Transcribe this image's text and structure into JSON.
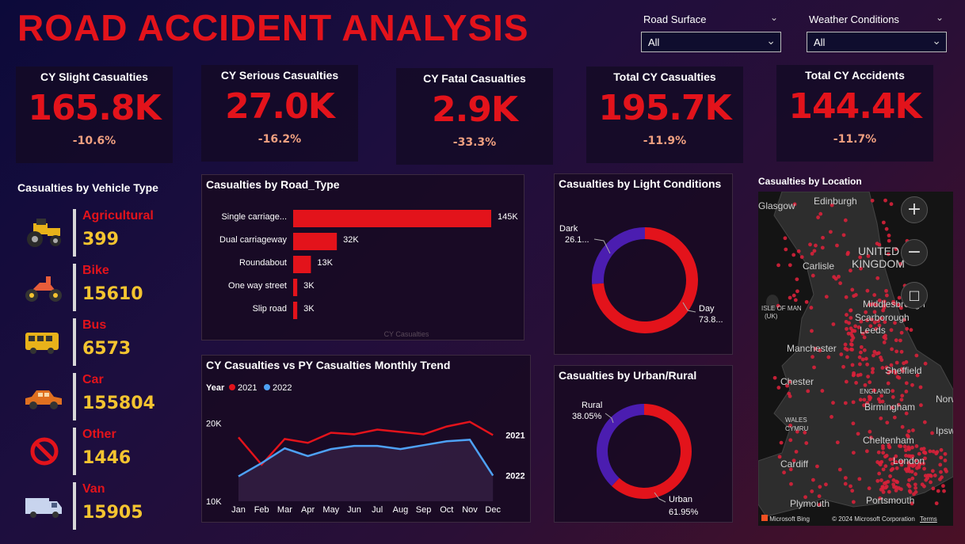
{
  "title": "ROAD ACCIDENT ANALYSIS",
  "filters": [
    {
      "label": "Road Surface",
      "value": "All"
    },
    {
      "label": "Weather Conditions",
      "value": "All"
    }
  ],
  "kpis": [
    {
      "title": "CY Slight Casualties",
      "value": "165.8K",
      "change": "-10.6%"
    },
    {
      "title": "CY Serious Casualties",
      "value": "27.0K",
      "change": "-16.2%"
    },
    {
      "title": "CY Fatal Casualties",
      "value": "2.9K",
      "change": "-33.3%"
    },
    {
      "title": "Total CY Casualties",
      "value": "195.7K",
      "change": "-11.9%"
    },
    {
      "title": "Total CY Accidents",
      "value": "144.4K",
      "change": "-11.7%"
    }
  ],
  "vehicle": {
    "title": "Casualties by Vehicle Type",
    "items": [
      {
        "name": "Agricultural",
        "value": "399",
        "icon": "tractor-icon"
      },
      {
        "name": "Bike",
        "value": "15610",
        "icon": "motorbike-icon"
      },
      {
        "name": "Bus",
        "value": "6573",
        "icon": "bus-icon"
      },
      {
        "name": "Car",
        "value": "155804",
        "icon": "car-icon"
      },
      {
        "name": "Other",
        "value": "1446",
        "icon": "prohibited-icon"
      },
      {
        "name": "Van",
        "value": "15905",
        "icon": "van-icon"
      }
    ]
  },
  "road_type": {
    "title": "Casualties by Road_Type",
    "axis_label": "CY Casualties"
  },
  "trend": {
    "title": "CY Casualties vs PY Casualties Monthly Trend",
    "legend_title": "Year"
  },
  "light": {
    "title": "Casualties by Light Conditions"
  },
  "urban": {
    "title": "Casualties by Urban/Rural"
  },
  "map": {
    "title": "Casualties by Location",
    "places": [
      "Edinburgh",
      "UNITED",
      "KINGDOM",
      "Carlisle",
      "ISLE OF MAN",
      "(UK)",
      "Middlesbrough",
      "Scarborough",
      "Leeds",
      "Manchester",
      "Sheffield",
      "Chester",
      "ENGLAND",
      "WALES",
      "CYMRU",
      "Birmingham",
      "Norwich",
      "Ipswich",
      "Cheltenham",
      "London",
      "Cardiff",
      "Plymouth",
      "Portsmouth",
      "Glasgow"
    ],
    "attribution_left": "Microsoft Bing",
    "attribution_right": "© 2024 Microsoft Corporation",
    "terms": "Terms"
  },
  "colors": {
    "red": "#e3131b",
    "blue": "#4ea1f5",
    "purple": "#4b1db0",
    "yellow": "#f4c430"
  },
  "chart_data": [
    {
      "type": "bar",
      "title": "Casualties by Road_Type",
      "orientation": "horizontal",
      "xlabel": "CY Casualties",
      "categories": [
        "Single carriage...",
        "Dual carriageway",
        "Roundabout",
        "One way street",
        "Slip road"
      ],
      "values": [
        145000,
        32000,
        13000,
        3000,
        3000
      ],
      "labels": [
        "145K",
        "32K",
        "13K",
        "3K",
        "3K"
      ]
    },
    {
      "type": "line",
      "title": "CY Casualties vs PY Casualties Monthly Trend",
      "categories": [
        "Jan",
        "Feb",
        "Mar",
        "Apr",
        "May",
        "Jun",
        "Jul",
        "Aug",
        "Sep",
        "Oct",
        "Nov",
        "Dec"
      ],
      "yticks": [
        "10K",
        "20K"
      ],
      "ylim": [
        10000,
        22000
      ],
      "series": [
        {
          "name": "2021",
          "end_label": "2021",
          "values": [
            18200,
            14700,
            18000,
            17500,
            18800,
            18600,
            19200,
            18900,
            18600,
            19600,
            20200,
            18500
          ]
        },
        {
          "name": "2022",
          "end_label": "2022",
          "values": [
            13200,
            14900,
            16800,
            15800,
            16700,
            17100,
            17100,
            16700,
            17200,
            17700,
            17900,
            13300
          ]
        }
      ]
    },
    {
      "type": "pie",
      "title": "Casualties by Light Conditions",
      "donut": true,
      "slices": [
        {
          "name": "Day",
          "value": 73.8,
          "label": "73.8..."
        },
        {
          "name": "Dark",
          "value": 26.1,
          "label": "26.1..."
        }
      ]
    },
    {
      "type": "pie",
      "title": "Casualties by Urban/Rural",
      "donut": true,
      "slices": [
        {
          "name": "Urban",
          "value": 61.95,
          "label": "61.95%"
        },
        {
          "name": "Rural",
          "value": 38.05,
          "label": "38.05%"
        }
      ]
    }
  ]
}
